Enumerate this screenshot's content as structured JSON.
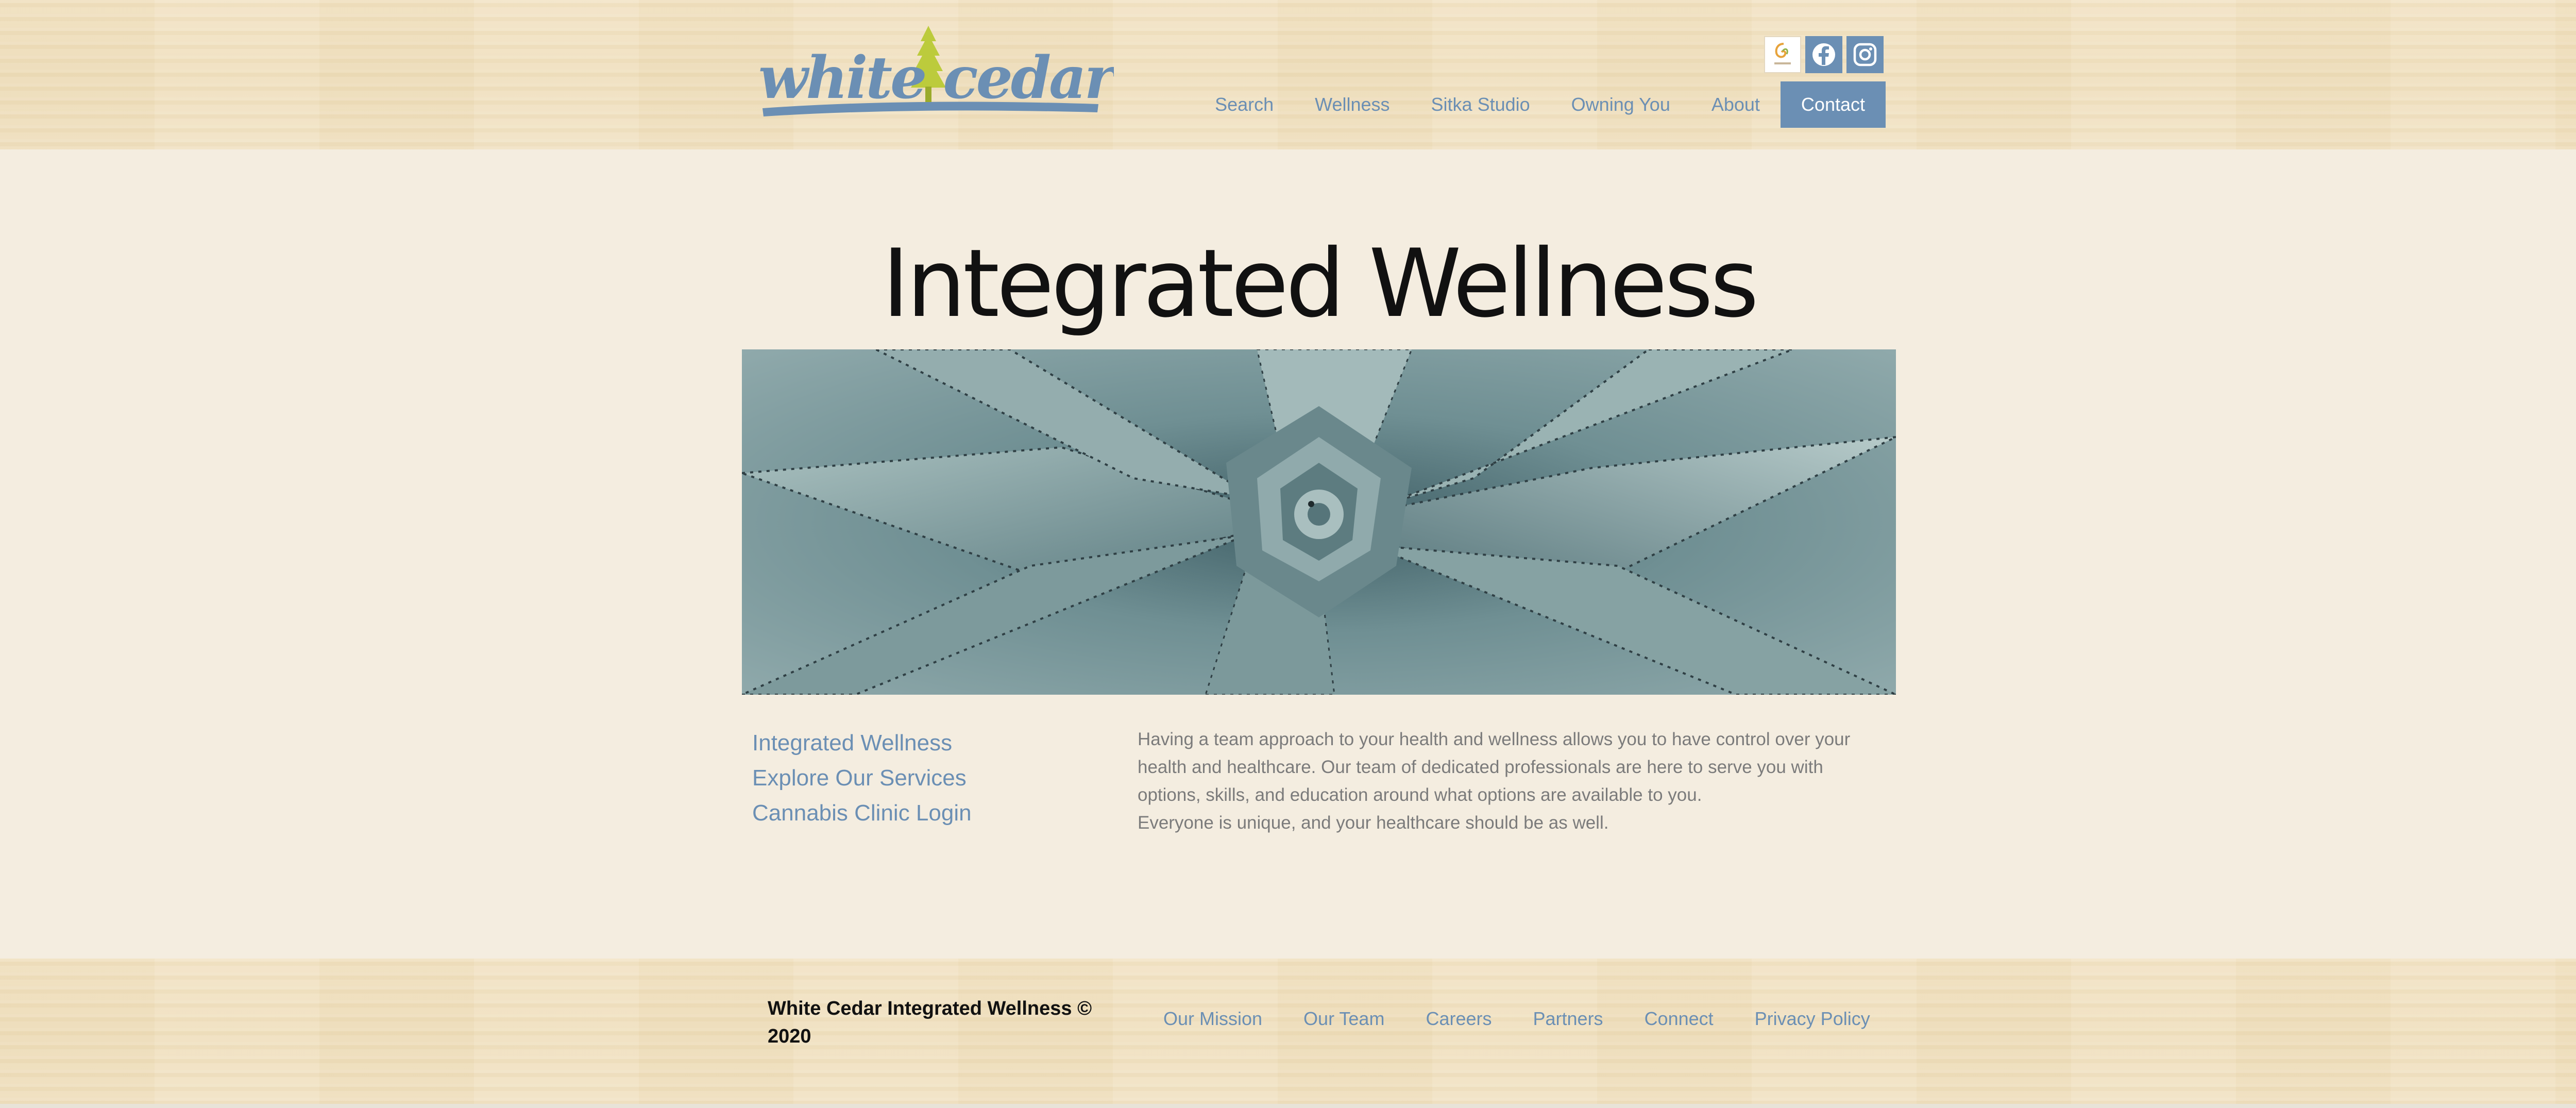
{
  "header": {
    "logo_text": "white cedar",
    "social": [
      {
        "icon": "integrated-logo-icon"
      },
      {
        "icon": "facebook-icon"
      },
      {
        "icon": "instagram-icon"
      }
    ],
    "nav": [
      {
        "label": "Search"
      },
      {
        "label": "Wellness"
      },
      {
        "label": "Sitka Studio"
      },
      {
        "label": "Owning You"
      },
      {
        "label": "About"
      },
      {
        "label": "Contact",
        "active": true
      }
    ]
  },
  "main": {
    "title": "Integrated Wellness",
    "hero_image": "agave-succulent-photo",
    "side_links": [
      "Integrated Wellness",
      "Explore Our Services",
      "Cannabis Clinic Login"
    ],
    "body": [
      "Having a team approach to your health and wellness allows you to have control over your health and healthcare. Our team of dedicated professionals are here to serve you with options, skills, and education around what options are available to you.",
      "Everyone is unique, and your healthcare should be as well."
    ]
  },
  "footer": {
    "brand": "White Cedar Integrated Wellness © 2020",
    "links": [
      "Our Mission",
      "Our Team",
      "Careers",
      "Partners",
      "Connect",
      "Privacy Policy"
    ]
  },
  "colors": {
    "accent": "#6b8fb4",
    "background": "#f4ede0",
    "wood": "#f0e0c0",
    "tree_green": "#b9c93a"
  }
}
